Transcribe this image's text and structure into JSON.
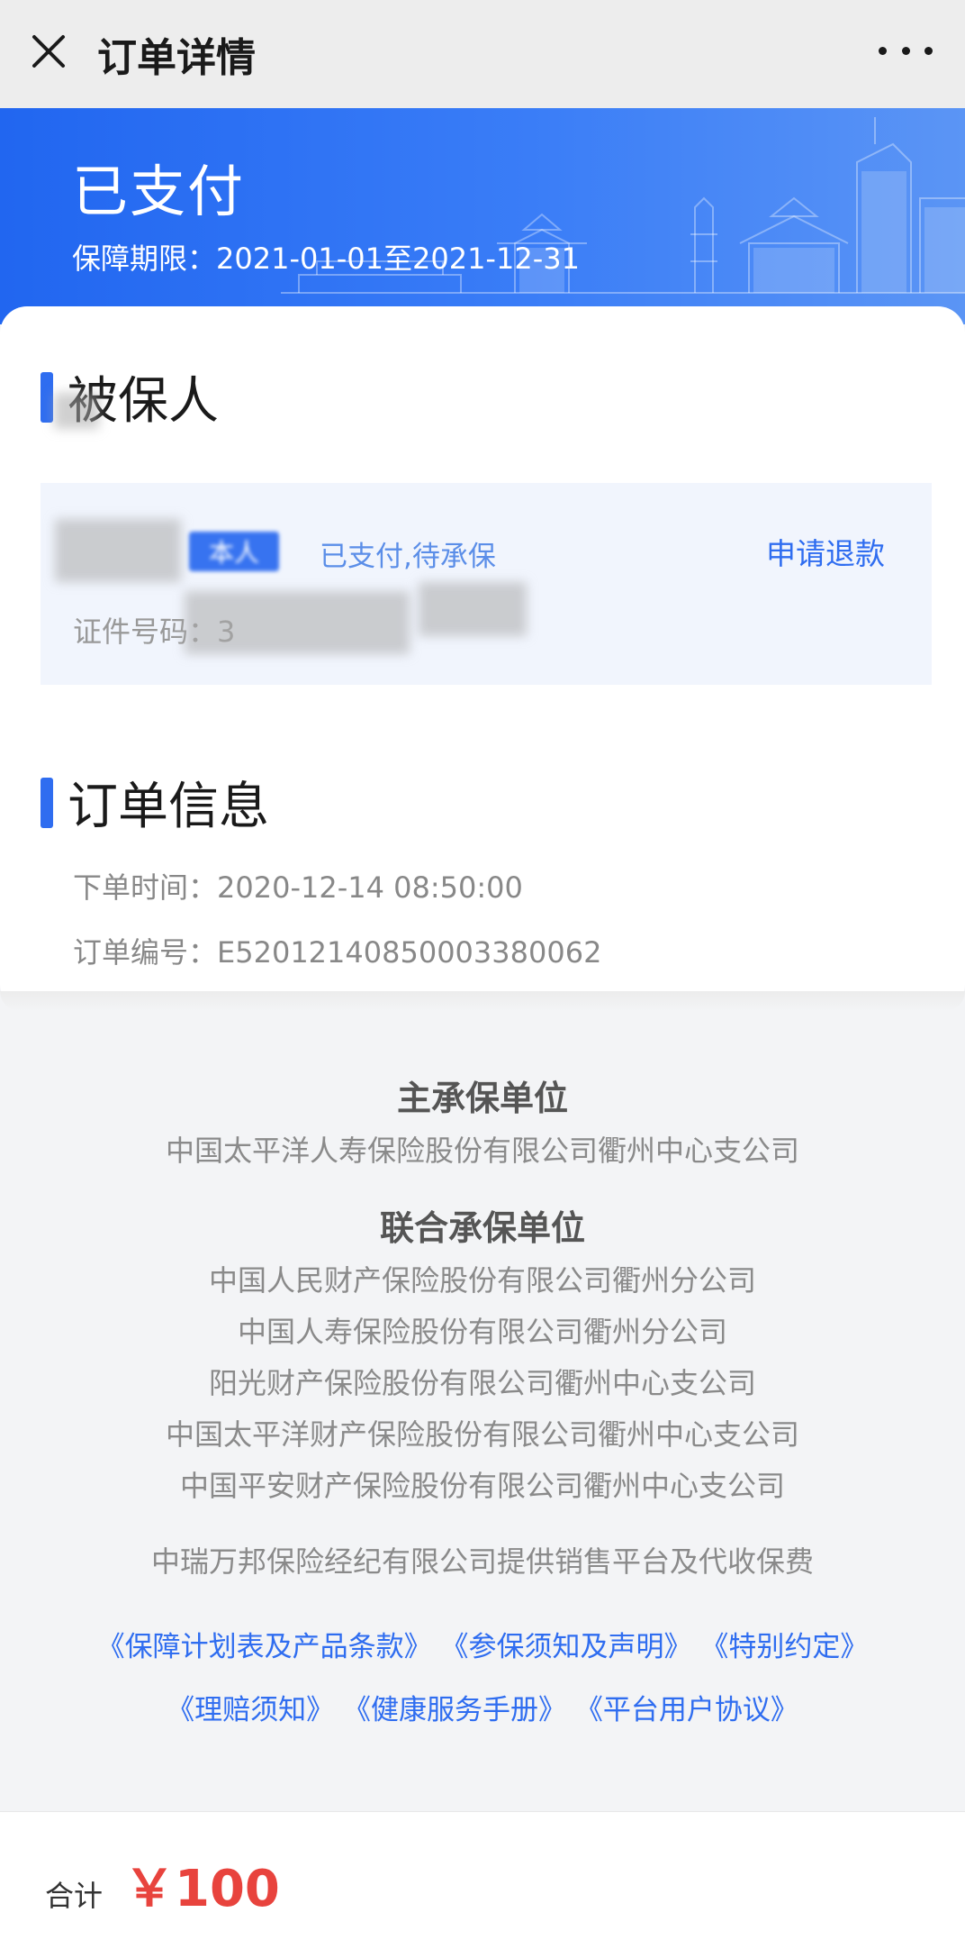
{
  "topbar": {
    "title": "订单详情",
    "close_icon": "close-icon",
    "more_icon": "more-dots-icon"
  },
  "hero": {
    "status": "已支付",
    "period_label": "保障期限：",
    "period_value": "2021-01-01至2021-12-31",
    "bg_color": "#2166f0"
  },
  "insured": {
    "section_title": "被保人",
    "tag": "本人",
    "pay_status": "已支付,待承保",
    "refund_label": "申请退款",
    "id_label": "证件号码：3",
    "id_masked": true
  },
  "order": {
    "section_title": "订单信息",
    "time_label": "下单时间：",
    "time_value": "2020-12-14 08:50:00",
    "number_label": "订单编号：",
    "number_value": "E52012140850003380062"
  },
  "underwriters": {
    "main_title": "主承保单位",
    "main_company": "中国太平洋人寿保险股份有限公司衢州中心支公司",
    "joint_title": "联合承保单位",
    "joint_companies": [
      "中国人民财产保险股份有限公司衢州分公司",
      "中国人寿保险股份有限公司衢州分公司",
      "阳光财产保险股份有限公司衢州中心支公司",
      "中国太平洋财产保险股份有限公司衢州中心支公司",
      "中国平安财产保险股份有限公司衢州中心支公司"
    ],
    "platform_note": "中瑞万邦保险经纪有限公司提供销售平台及代收保费"
  },
  "links": {
    "row1": [
      "《保障计划表及产品条款》",
      "《参保须知及声明》",
      "《特别约定》"
    ],
    "row2": [
      "《理赔须知》",
      "《健康服务手册》",
      "《平台用户协议》"
    ],
    "color": "#2f6df0"
  },
  "footer": {
    "total_label": "合计",
    "total_amount": "￥100",
    "amount_color": "#e8433d"
  }
}
